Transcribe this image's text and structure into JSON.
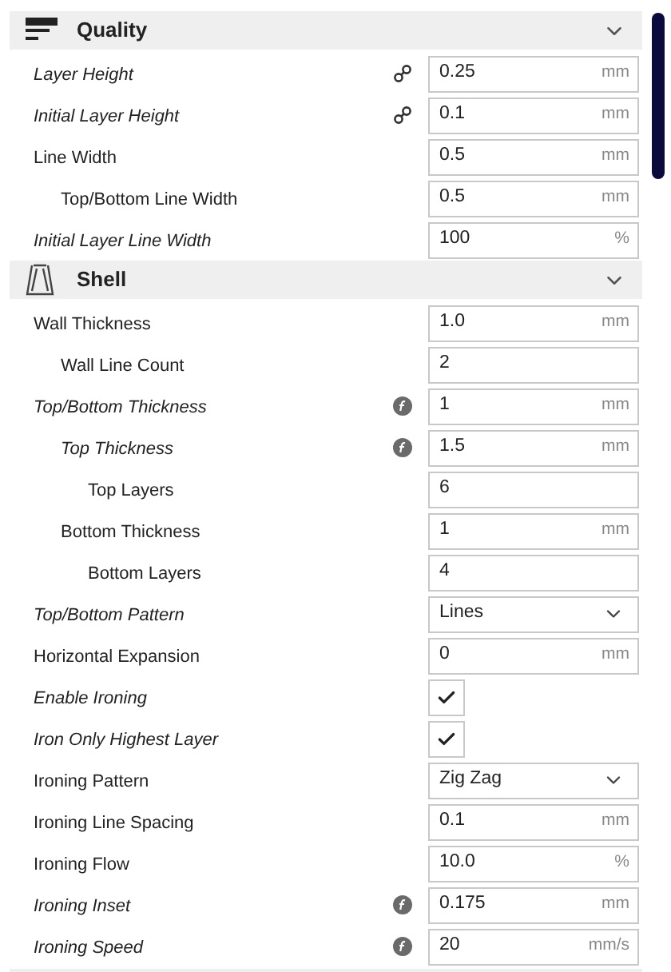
{
  "sections": [
    {
      "title": "Quality",
      "expanded": true,
      "settings": [
        {
          "kind": "number",
          "label": "Layer Height",
          "modified": true,
          "linked": true,
          "formula": false,
          "value": "0.25",
          "unit": "mm"
        },
        {
          "kind": "number",
          "label": "Initial Layer Height",
          "modified": true,
          "linked": true,
          "formula": false,
          "value": "0.1",
          "unit": "mm"
        },
        {
          "kind": "number",
          "label": "Line Width",
          "modified": false,
          "linked": false,
          "formula": false,
          "value": "0.5",
          "unit": "mm",
          "children": [
            {
              "kind": "number",
              "label": "Top/Bottom Line Width",
              "modified": false,
              "linked": false,
              "formula": false,
              "value": "0.5",
              "unit": "mm"
            }
          ]
        },
        {
          "kind": "number",
          "label": "Initial Layer Line Width",
          "modified": true,
          "linked": false,
          "formula": false,
          "value": "100",
          "unit": "%"
        }
      ]
    },
    {
      "title": "Shell",
      "expanded": true,
      "settings": [
        {
          "kind": "number",
          "label": "Wall Thickness",
          "modified": false,
          "linked": false,
          "formula": false,
          "value": "1.0",
          "unit": "mm",
          "children": [
            {
              "kind": "number",
              "label": "Wall Line Count",
              "modified": false,
              "linked": false,
              "formula": false,
              "value": "2"
            }
          ]
        },
        {
          "kind": "number",
          "label": "Top/Bottom Thickness",
          "modified": true,
          "linked": false,
          "formula": true,
          "value": "1",
          "unit": "mm",
          "children": [
            {
              "kind": "number",
              "label": "Top Thickness",
              "modified": true,
              "linked": false,
              "formula": true,
              "value": "1.5",
              "unit": "mm",
              "children": [
                {
                  "kind": "number",
                  "label": "Top Layers",
                  "modified": false,
                  "linked": false,
                  "formula": false,
                  "value": "6"
                }
              ]
            },
            {
              "kind": "number",
              "label": "Bottom Thickness",
              "modified": false,
              "linked": false,
              "formula": false,
              "value": "1",
              "unit": "mm",
              "children": [
                {
                  "kind": "number",
                  "label": "Bottom Layers",
                  "modified": false,
                  "linked": false,
                  "formula": false,
                  "value": "4"
                }
              ]
            }
          ]
        },
        {
          "kind": "dropdown",
          "label": "Top/Bottom Pattern",
          "modified": true,
          "linked": false,
          "formula": false,
          "value": "Lines"
        },
        {
          "kind": "number",
          "label": "Horizontal Expansion",
          "modified": false,
          "linked": false,
          "formula": false,
          "value": "0",
          "unit": "mm"
        },
        {
          "kind": "checkbox",
          "label": "Enable Ironing",
          "modified": true,
          "linked": false,
          "formula": false,
          "checked": true
        },
        {
          "kind": "checkbox",
          "label": "Iron Only Highest Layer",
          "modified": true,
          "linked": false,
          "formula": false,
          "checked": true
        },
        {
          "kind": "dropdown",
          "label": "Ironing Pattern",
          "modified": false,
          "linked": false,
          "formula": false,
          "value": "Zig Zag"
        },
        {
          "kind": "number",
          "label": "Ironing Line Spacing",
          "modified": false,
          "linked": false,
          "formula": false,
          "value": "0.1",
          "unit": "mm"
        },
        {
          "kind": "number",
          "label": "Ironing Flow",
          "modified": false,
          "linked": false,
          "formula": false,
          "value": "10.0",
          "unit": "%"
        },
        {
          "kind": "number",
          "label": "Ironing Inset",
          "modified": true,
          "linked": false,
          "formula": true,
          "value": "0.175",
          "unit": "mm"
        },
        {
          "kind": "number",
          "label": "Ironing Speed",
          "modified": true,
          "linked": false,
          "formula": true,
          "value": "20",
          "unit": "mm/s"
        }
      ]
    }
  ]
}
